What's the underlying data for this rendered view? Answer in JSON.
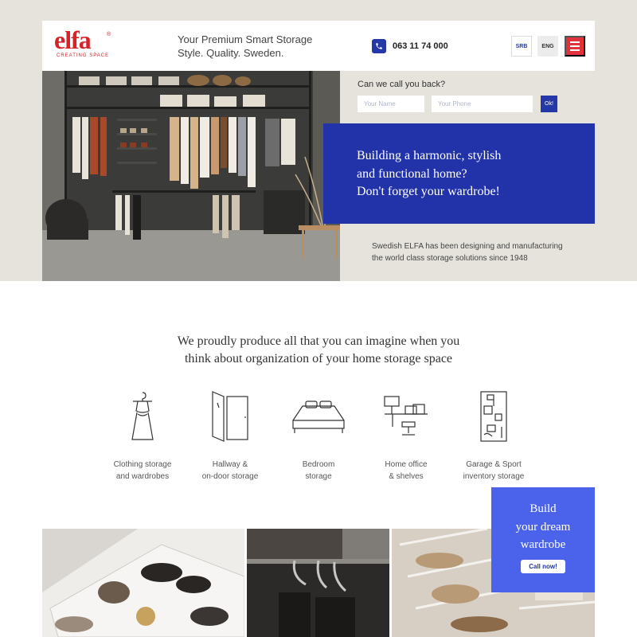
{
  "header": {
    "logo": {
      "name": "elfa",
      "tagline": "CREATING SPACE"
    },
    "tagline": {
      "line1": "Your Premium Smart Storage",
      "line2": "Style. Quality. Sweden."
    },
    "phone": "063 11 74 000",
    "languages": [
      "SRB",
      "ENG"
    ],
    "menu_icon": "hamburger-icon"
  },
  "callback": {
    "title": "Can we call you back?",
    "name_placeholder": "Your Name",
    "phone_placeholder": "Your Phone",
    "submit_label": "Ok!"
  },
  "hero": {
    "headline": [
      "Building a harmonic, stylish",
      "and functional home?",
      "Don't forget your wardrobe!"
    ],
    "intro": [
      "Swedish ELFA has been designing and manufacturing",
      "the world class storage solutions since 1948"
    ]
  },
  "section": {
    "title": [
      "We proudly produce all that you can imagine when you",
      "think about organization of your home storage space"
    ]
  },
  "categories": [
    {
      "icon": "dress-hanger-icon",
      "label": [
        "Clothing storage",
        "and wardrobes"
      ]
    },
    {
      "icon": "door-icon",
      "label": [
        "Hallway &",
        "on-door storage"
      ]
    },
    {
      "icon": "bed-icon",
      "label": [
        "Bedroom",
        "storage"
      ]
    },
    {
      "icon": "desk-icon",
      "label": [
        "Home office",
        "& shelves"
      ]
    },
    {
      "icon": "shelving-icon",
      "label": [
        "Garage & Sport",
        "inventory storage"
      ]
    }
  ],
  "cta": {
    "text": [
      "Build",
      "your dream",
      "wardrobe"
    ],
    "button_label": "Call now!"
  },
  "colors": {
    "brand_red": "#d6232a",
    "brand_blue": "#2232a8",
    "cta_blue": "#4a63ea",
    "band_beige": "#e6e3dd"
  }
}
